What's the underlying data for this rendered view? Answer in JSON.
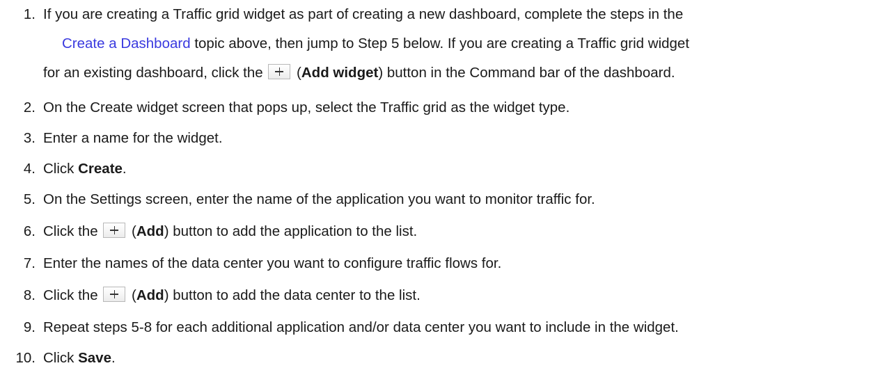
{
  "steps": [
    {
      "num": "1.",
      "l1": "If you are creating a Traffic grid widget as part of creating a new dashboard, complete the steps in the",
      "link": "Create a Dashboard",
      "l2_after_link": " topic above, then jump to Step 5 below. If you are creating a Traffic grid widget",
      "l3_before": "for an existing dashboard, click the ",
      "l3_open": " (",
      "l3_bold": "Add widget",
      "l3_after": ") button in the Command bar of the dashboard."
    },
    {
      "num": "2.",
      "text": "On the Create widget screen that pops up, select the Traffic grid as the widget type."
    },
    {
      "num": "3.",
      "text": "Enter a name for the widget."
    },
    {
      "num": "4.",
      "before": "Click ",
      "bold": "Create",
      "after": "."
    },
    {
      "num": "5.",
      "text": "On the Settings screen, enter the name of the application you want to monitor traffic for."
    },
    {
      "num": "6.",
      "before": "Click the ",
      "open": " (",
      "bold": "Add",
      "after": ") button to add the application to the list."
    },
    {
      "num": "7.",
      "text": "Enter the names of the data center you want to configure traffic flows for."
    },
    {
      "num": "8.",
      "before": "Click the ",
      "open": " (",
      "bold": "Add",
      "after": ") button to add the data center to the list."
    },
    {
      "num": "9.",
      "text": "Repeat steps 5-8 for each additional application and/or data center you want to include in the widget."
    },
    {
      "num": "10.",
      "before": "Click ",
      "bold": "Save",
      "after": "."
    }
  ],
  "icons": {
    "add_button_icon": "plus-icon"
  },
  "colors": {
    "link": "#3a3adf",
    "text": "#1a1a1a"
  }
}
